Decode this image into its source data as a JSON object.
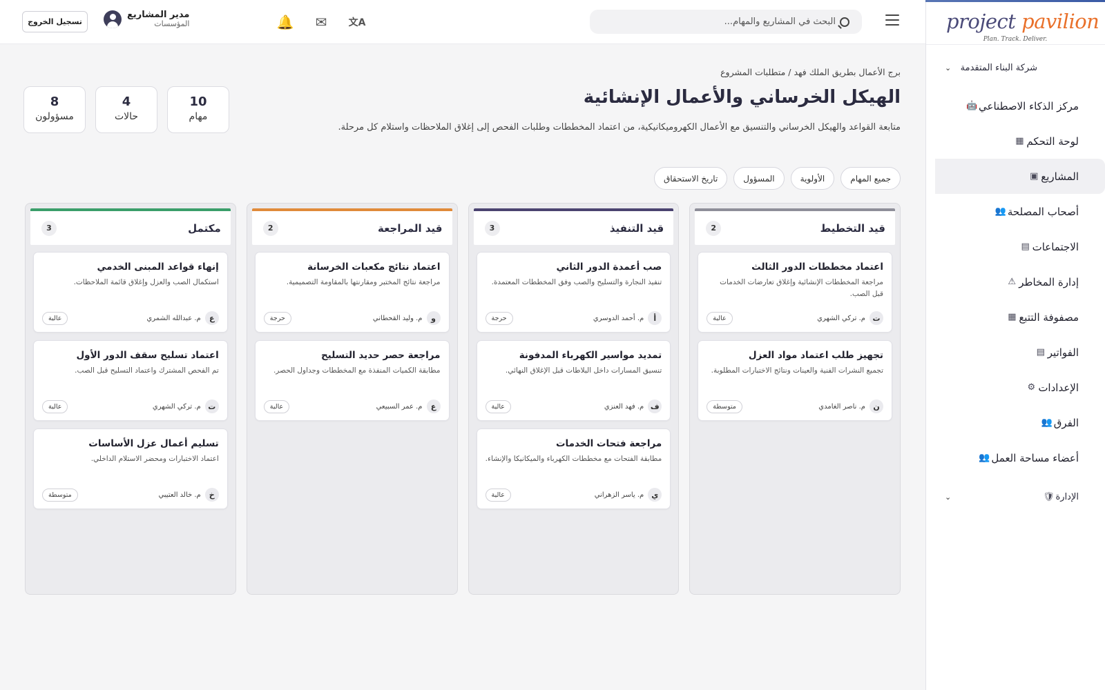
{
  "sidebar": {
    "logo_part1": "project ",
    "logo_part2": "pavilion",
    "tagline": "Plan. Track. Deliver.",
    "company": "شركة البناء المتقدمة",
    "items": [
      {
        "label": "مركز الذكاء الاصطناعي",
        "icon": "robot-icon",
        "glyph": "🤖"
      },
      {
        "label": "لوحة التحكم",
        "icon": "dashboard-icon",
        "glyph": "▦"
      },
      {
        "label": "المشاريع",
        "icon": "folder-icon",
        "glyph": "▣"
      },
      {
        "label": "أصحاب المصلحة",
        "icon": "people-icon",
        "glyph": "👥"
      },
      {
        "label": "الاجتماعات",
        "icon": "calendar-icon",
        "glyph": "▤"
      },
      {
        "label": "إدارة المخاطر",
        "icon": "warning-icon",
        "glyph": "⚠"
      },
      {
        "label": "مصفوفة التتبع",
        "icon": "grid-icon",
        "glyph": "▦"
      },
      {
        "label": "الفواتير",
        "icon": "invoice-icon",
        "glyph": "▤"
      },
      {
        "label": "الإعدادات",
        "icon": "gear-icon",
        "glyph": "⚙"
      },
      {
        "label": "الفرق",
        "icon": "team-icon",
        "glyph": "👥"
      },
      {
        "label": "أعضاء مساحة العمل",
        "icon": "members-icon",
        "glyph": "👥"
      }
    ],
    "admin": "الإدارة",
    "admin_glyph": "🛡"
  },
  "topbar": {
    "search_placeholder": "البحث في المشاريع والمهام...",
    "user_name": "مدير المشاريع",
    "user_org": "المؤسسات",
    "logout": "تسجيل الخروج",
    "translate_glyph": "文A",
    "mail_glyph": "✉",
    "bell_glyph": "🔔"
  },
  "main": {
    "breadcrumb": "برج الأعمال بطريق الملك فهد / متطلبات المشروع",
    "title": "الهيكل الخرساني والأعمال الإنشائية",
    "description": "متابعة القواعد والهيكل الخرساني والتنسيق مع الأعمال الكهروميكانيكية، من اعتماد المخططات وطلبات الفحص إلى إغلاق الملاحظات واستلام كل مرحلة.",
    "stats": [
      {
        "value": "8",
        "label": "مسؤولون"
      },
      {
        "value": "4",
        "label": "حالات"
      },
      {
        "value": "10",
        "label": "مهام"
      }
    ],
    "filters": [
      "جميع المهام",
      "الأولوية",
      "المسؤول",
      "تاريخ الاستحقاق"
    ]
  },
  "board": {
    "columns": [
      {
        "title": "قيد التخطيط",
        "count": "2",
        "color": "#8e8e99",
        "cards": [
          {
            "title": "اعتماد مخططات الدور الثالث",
            "desc": "مراجعة المخططات الإنشائية وإغلاق تعارضات الخدمات قبل الصب.",
            "initial": "ت",
            "assignee": "م. تركي الشهري",
            "priority": "عالية"
          },
          {
            "title": "تجهيز طلب اعتماد مواد العزل",
            "desc": "تجميع النشرات الفنية والعينات ونتائج الاختبارات المطلوبة.",
            "initial": "ن",
            "assignee": "م. ناصر الغامدي",
            "priority": "متوسطة"
          }
        ]
      },
      {
        "title": "قيد التنفيذ",
        "count": "3",
        "color": "#4a4370",
        "cards": [
          {
            "title": "صب أعمدة الدور الثاني",
            "desc": "تنفيذ النجارة والتسليح والصب وفق المخططات المعتمدة.",
            "initial": "أ",
            "assignee": "م. أحمد الدوسري",
            "priority": "حرجة"
          },
          {
            "title": "تمديد مواسير الكهرباء المدفونة",
            "desc": "تنسيق المسارات داخل البلاطات قبل الإغلاق النهائي.",
            "initial": "ف",
            "assignee": "م. فهد العنزي",
            "priority": "عالية"
          },
          {
            "title": "مراجعة فتحات الخدمات",
            "desc": "مطابقة الفتحات مع مخططات الكهرباء والميكانيكا والإنشاء.",
            "initial": "ي",
            "assignee": "م. ياسر الزهراني",
            "priority": "عالية"
          }
        ]
      },
      {
        "title": "قيد المراجعة",
        "count": "2",
        "color": "#e08a3a",
        "cards": [
          {
            "title": "اعتماد نتائج مكعبات الخرسانة",
            "desc": "مراجعة نتائج المختبر ومقارنتها بالمقاومة التصميمية.",
            "initial": "و",
            "assignee": "م. وليد القحطاني",
            "priority": "حرجة"
          },
          {
            "title": "مراجعة حصر حديد التسليح",
            "desc": "مطابقة الكميات المنفذة مع المخططات وجداول الحصر.",
            "initial": "ع",
            "assignee": "م. عمر السبيعي",
            "priority": "عالية"
          }
        ]
      },
      {
        "title": "مكتمل",
        "count": "3",
        "color": "#3a9e6a",
        "cards": [
          {
            "title": "إنهاء قواعد المبنى الخدمي",
            "desc": "استكمال الصب والعزل وإغلاق قائمة الملاحظات.",
            "initial": "ع",
            "assignee": "م. عبدالله الشمري",
            "priority": "عالية"
          },
          {
            "title": "اعتماد تسليح سقف الدور الأول",
            "desc": "تم الفحص المشترك واعتماد التسليح قبل الصب.",
            "initial": "ت",
            "assignee": "م. تركي الشهري",
            "priority": "عالية"
          },
          {
            "title": "تسليم أعمال عزل الأساسات",
            "desc": "اعتماد الاختبارات ومحضر الاستلام الداخلي.",
            "initial": "خ",
            "assignee": "م. خالد العتيبي",
            "priority": "متوسطة"
          }
        ]
      }
    ]
  }
}
